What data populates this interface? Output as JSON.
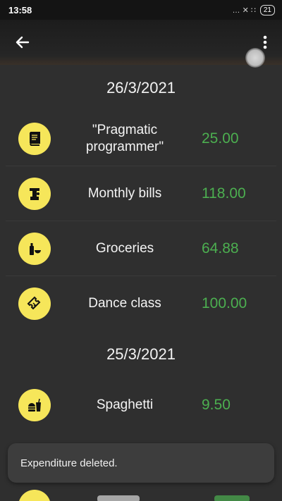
{
  "status_bar": {
    "time": "13:58",
    "icons": "… ✕ ∷",
    "battery": "21"
  },
  "app_bar": {
    "back_icon": "arrow-back-icon",
    "menu_icon": "more-vert-icon"
  },
  "sections": [
    {
      "date": "26/3/2021",
      "items": [
        {
          "title": "\"Pragmatic\nprogrammer\"",
          "amount": "25.00",
          "icon": "book-icon"
        },
        {
          "title": "Monthly bills",
          "amount": "118.00",
          "icon": "faucet-icon"
        },
        {
          "title": "Groceries",
          "amount": "64.88",
          "icon": "groceries-icon"
        },
        {
          "title": "Dance class",
          "amount": "100.00",
          "icon": "ticket-icon"
        }
      ]
    },
    {
      "date": "25/3/2021",
      "items": [
        {
          "title": "Spaghetti",
          "amount": "9.50",
          "icon": "fastfood-icon"
        }
      ]
    }
  ],
  "snackbar": {
    "message": "Expenditure deleted."
  },
  "colors": {
    "accent_yellow": "#f6e65a",
    "amount_green": "#4caf50",
    "background": "#2f2f2f"
  }
}
